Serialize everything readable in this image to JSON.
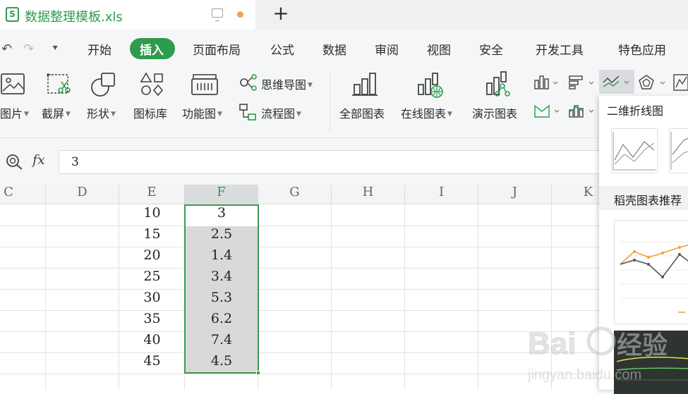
{
  "window": {
    "file_name": "数据整理模板.xls",
    "file_icon_letter": "S",
    "new_tab_glyph": "+"
  },
  "menu": {
    "items": [
      "开始",
      "插入",
      "页面布局",
      "公式",
      "数据",
      "审阅",
      "视图",
      "安全",
      "开发工具",
      "特色应用"
    ],
    "active": "插入"
  },
  "ribbon": {
    "picture_label": "图片",
    "screenshot_label": "截屏",
    "shapes_label": "形状",
    "icon_library_label": "图标库",
    "function_chart_label": "功能图",
    "mindmap_label": "思维导图",
    "flowchart_label": "流程图",
    "all_charts_label": "全部图表",
    "online_charts_label": "在线图表",
    "demo_charts_label": "演示图表"
  },
  "formula_bar": {
    "fx": "fx",
    "value": "3"
  },
  "columns": [
    "C",
    "D",
    "E",
    "F",
    "G",
    "H",
    "I",
    "J",
    "K"
  ],
  "selected_column": "F",
  "rows": [
    {
      "E": "10",
      "F": "3"
    },
    {
      "E": "15",
      "F": "2.5"
    },
    {
      "E": "20",
      "F": "1.4"
    },
    {
      "E": "25",
      "F": "3.4"
    },
    {
      "E": "30",
      "F": "5.3"
    },
    {
      "E": "35",
      "F": "6.2"
    },
    {
      "E": "40",
      "F": "7.4"
    },
    {
      "E": "45",
      "F": "4.5"
    }
  ],
  "chart_panel": {
    "title": "二维折线图",
    "recommend_label": "稻壳图表推荐"
  },
  "watermark": {
    "brand": "Bai 经验",
    "url": "jingyan.baidu.com"
  },
  "colors": {
    "accent": "#2f9b4c",
    "selection_fill": "#d9d9d9",
    "unsaved_dot": "#f0a15c"
  }
}
